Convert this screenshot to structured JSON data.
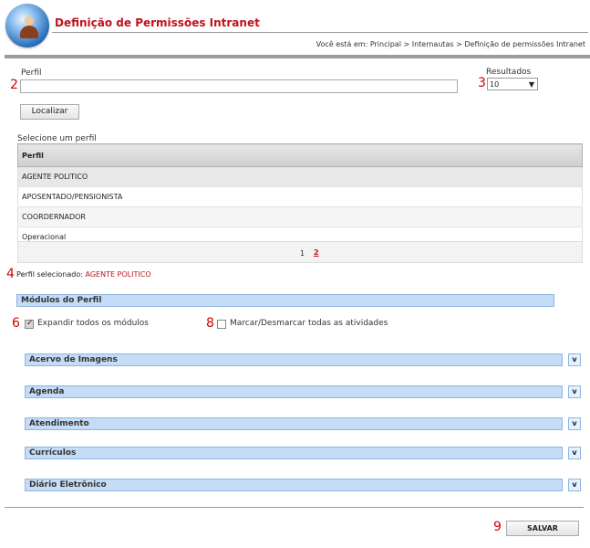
{
  "header": {
    "title": "Definição de Permissões Intranet",
    "breadcrumb": "Você está em: Principal > Internautas > Definição de permissões Intranet"
  },
  "markers": {
    "m2a": "2",
    "m3": "3",
    "m4": "4",
    "m6": "6",
    "m8": "8",
    "m9": "9"
  },
  "search": {
    "perfil_label": "Perfil",
    "perfil_value": "",
    "results_label": "Resultados",
    "results_value": "10",
    "localizar": "Localizar"
  },
  "profiles": {
    "section_label": "Selecione um perfil",
    "column": "Perfil",
    "rows": [
      "AGENTE POLITICO",
      "APOSENTADO/PENSIONISTA",
      "COORDERNADOR",
      "Operacional"
    ],
    "pages": [
      "1",
      "2"
    ]
  },
  "selected": {
    "label": "Perfil selecionado:",
    "value": "AGENTE POLITICO"
  },
  "modules": {
    "header": "Módulos do Perfil",
    "expand_all": "Expandir todos os módulos",
    "mark_all": "Marcar/Desmarcar todas as atividades",
    "items": [
      "Acervo de Imagens",
      "Agenda",
      "Atendimento",
      "Currículos",
      "Diário Eletrônico"
    ],
    "chevron": "v"
  },
  "actions": {
    "save": "SALVAR"
  }
}
